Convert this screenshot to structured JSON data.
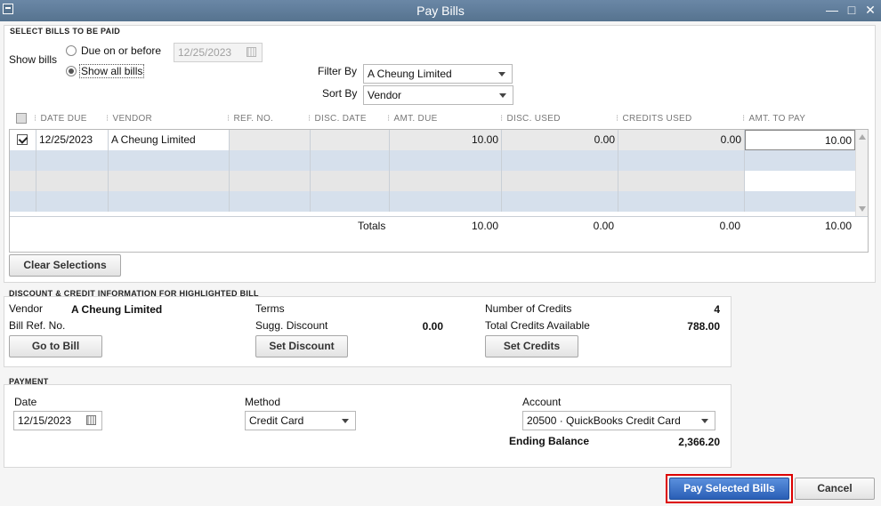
{
  "window": {
    "title": "Pay Bills"
  },
  "select_bills": {
    "section_title": "SELECT BILLS TO BE PAID",
    "show_bills_label": "Show bills",
    "option_due": "Due on or before",
    "option_all": "Show all bills",
    "selected_option": "Show all bills",
    "due_date_value": "12/25/2023",
    "filter_by_label": "Filter By",
    "filter_by_value": "A Cheung Limited",
    "sort_by_label": "Sort By",
    "sort_by_value": "Vendor"
  },
  "table": {
    "headers": [
      "DATE DUE",
      "VENDOR",
      "REF. NO.",
      "DISC. DATE",
      "AMT. DUE",
      "DISC. USED",
      "CREDITS USED",
      "AMT. TO PAY"
    ],
    "rows": [
      {
        "checked": true,
        "date_due": "12/25/2023",
        "vendor": "A Cheung Limited",
        "ref_no": "",
        "disc_date": "",
        "amt_due": "10.00",
        "disc_used": "0.00",
        "credits_used": "0.00",
        "amt_to_pay": "10.00"
      }
    ],
    "totals_label": "Totals",
    "totals": {
      "amt_due": "10.00",
      "disc_used": "0.00",
      "credits_used": "0.00",
      "amt_to_pay": "10.00"
    }
  },
  "clear_selections_label": "Clear Selections",
  "discount_info": {
    "section_title": "DISCOUNT & CREDIT INFORMATION FOR HIGHLIGHTED BILL",
    "vendor_label": "Vendor",
    "vendor_value": "A Cheung Limited",
    "bill_ref_label": "Bill Ref. No.",
    "terms_label": "Terms",
    "sugg_discount_label": "Sugg. Discount",
    "sugg_discount_value": "0.00",
    "num_credits_label": "Number of Credits",
    "num_credits_value": "4",
    "total_credits_label": "Total Credits Available",
    "total_credits_value": "788.00",
    "go_to_bill_label": "Go to Bill",
    "set_discount_label": "Set Discount",
    "set_credits_label": "Set Credits"
  },
  "payment": {
    "section_title": "PAYMENT",
    "date_label": "Date",
    "date_value": "12/15/2023",
    "method_label": "Method",
    "method_value": "Credit Card",
    "account_label": "Account",
    "account_value": "20500 · QuickBooks Credit Card",
    "ending_balance_label": "Ending Balance",
    "ending_balance_value": "2,366.20"
  },
  "actions": {
    "pay_label": "Pay Selected Bills",
    "cancel_label": "Cancel"
  }
}
